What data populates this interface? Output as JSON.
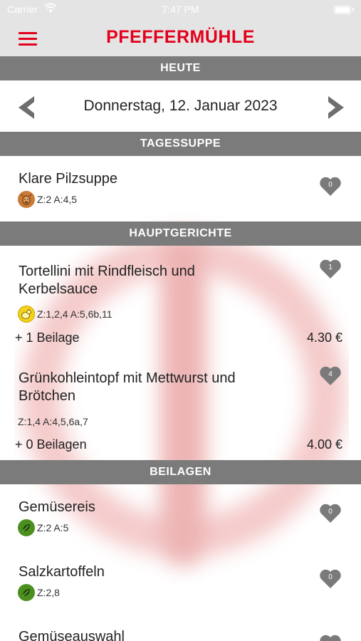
{
  "status_bar": {
    "carrier": "Carrier",
    "time": "7:47 PM"
  },
  "app": {
    "title": "PFEFFERMÜHLE"
  },
  "sections": {
    "today": "HEUTE",
    "soup": "TAGESSUPPE",
    "mains": "HAUPTGERICHTE",
    "sides": "BEILAGEN"
  },
  "date": {
    "label": "Donnerstag, 12. Januar 2023"
  },
  "soup": {
    "name": "Klare Pilzsuppe",
    "badge_icon": "beef-icon",
    "allergens": "Z:2 A:4,5",
    "likes": "0"
  },
  "mains": [
    {
      "name": "Tortellini mit Rindfleisch und Kerbelsauce",
      "badge_icon": "chicken-icon",
      "allergens": "Z:1,2,4 A:5,6b,11",
      "sides": "+ 1 Beilage",
      "price": "4.30 €",
      "likes": "1"
    },
    {
      "name": "Grünkohleintopf mit Mettwurst und Brötchen",
      "badge_icon": "",
      "allergens": "Z:1,4 A:4,5,6a,7",
      "sides": "+ 0 Beilagen",
      "price": "4.00 €",
      "likes": "4"
    }
  ],
  "side_dishes": [
    {
      "name": "Gemüsereis",
      "badge_icon": "vegan-leaf-icon",
      "allergens": "Z:2 A:5",
      "likes": "0"
    },
    {
      "name": "Salzkartoffeln",
      "badge_icon": "vegan-leaf-icon",
      "allergens": "Z:2,8",
      "likes": "0"
    },
    {
      "name": "Gemüseauswahl"
    }
  ],
  "colors": {
    "brand_red": "#e3001b",
    "header_gray": "#7b7b7b",
    "nav_gray": "#e4e4e4",
    "heart_gray": "#7a7a7a",
    "beef_badge": "#c97a35",
    "chicken_badge": "#f2d21a",
    "vegan_badge": "#4c8f1f"
  }
}
